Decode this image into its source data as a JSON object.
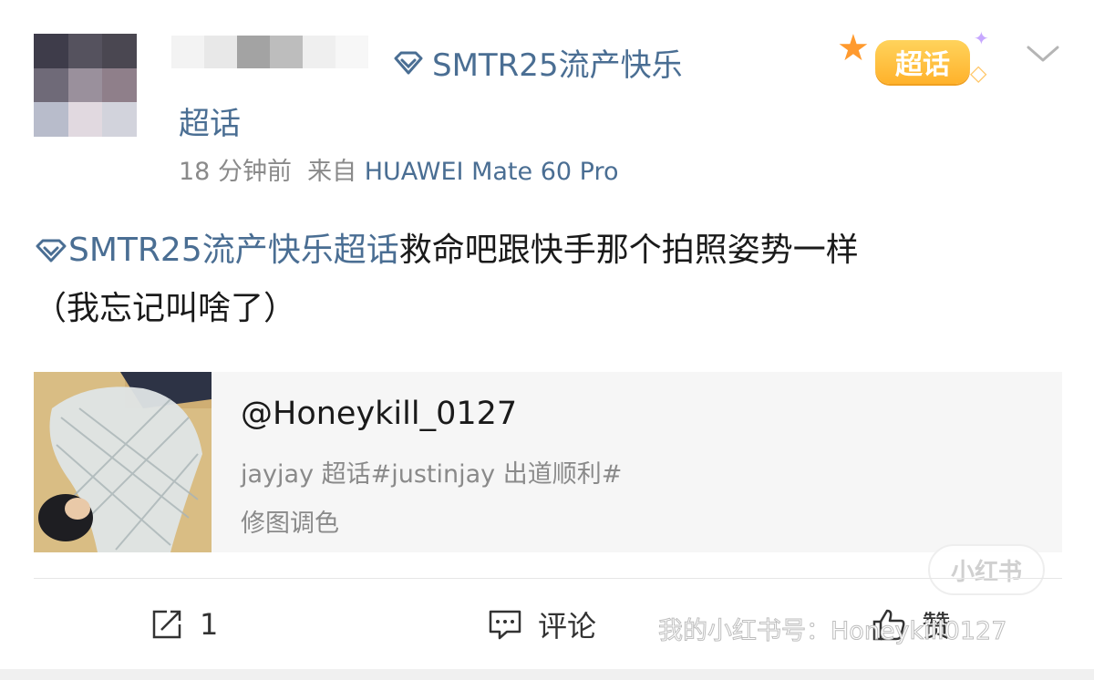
{
  "post": {
    "topic_title": "SMTR25流产快乐",
    "topic_title_cont": "超话",
    "badge_label": "超话",
    "time_ago": "18 分钟前",
    "from_label": "来自",
    "device": "HUAWEI Mate 60 Pro",
    "content_tag": "SMTR25流产快乐超话",
    "content_text": "救命吧跟快手那个拍照姿势一样",
    "content_text_2": "（我忘记叫啥了）",
    "card": {
      "title": "@Honeykill_0127",
      "desc": "jayjay 超话#justinjay 出道顺利#",
      "desc2": "修图调色"
    },
    "actions": {
      "repost_count": "1",
      "comment_label": "评论",
      "like_label": "赞"
    },
    "watermark": {
      "pill": "小红书",
      "text": "我的小红书号：Honeykill0127"
    }
  },
  "colors": {
    "link": "#4a6e93",
    "meta": "#8a8a8a",
    "card_bg": "#f6f6f6"
  },
  "icons": [
    "diamond-icon",
    "chevron-down-icon",
    "repost-icon",
    "comment-icon",
    "like-icon"
  ]
}
